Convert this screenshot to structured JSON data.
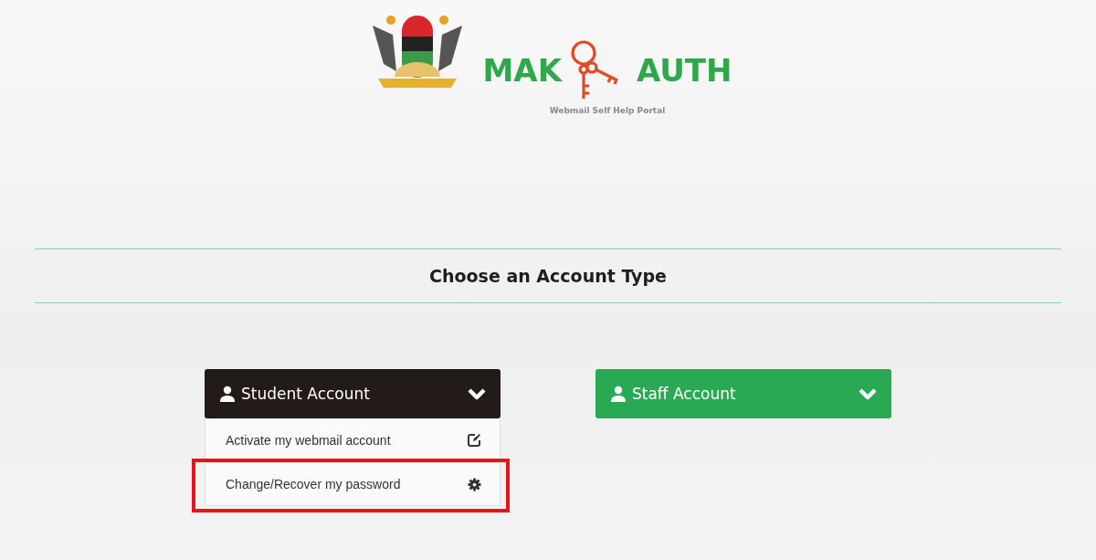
{
  "header": {
    "brand_left": "MAK",
    "brand_right": "AUTH",
    "subtitle": "Webmail Self Help Portal"
  },
  "heading": "Choose an Account Type",
  "accounts": [
    {
      "label": "Student Account",
      "expanded": true,
      "items": [
        {
          "label": "Activate my webmail account",
          "highlighted": false
        },
        {
          "label": "Change/Recover my password",
          "highlighted": true
        }
      ]
    },
    {
      "label": "Staff Account",
      "expanded": false
    }
  ]
}
